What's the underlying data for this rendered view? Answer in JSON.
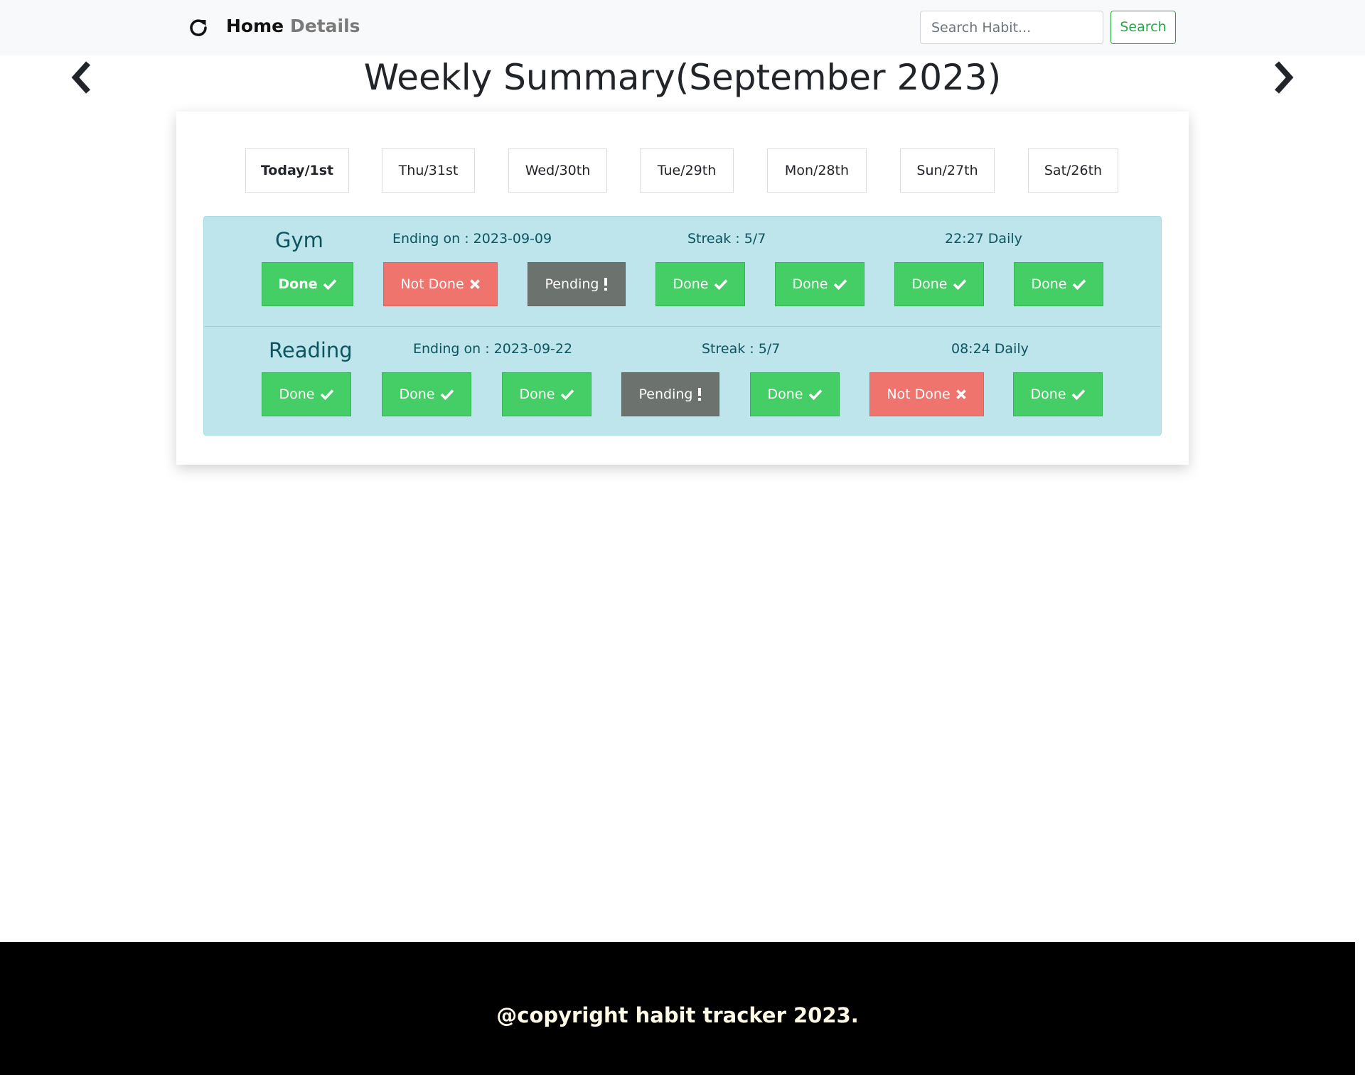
{
  "nav": {
    "home_label": "Home",
    "details_label": "Details",
    "search_placeholder": "Search Habit...",
    "search_button": "Search",
    "refresh_icon": "refresh-icon"
  },
  "page": {
    "title": "Weekly Summary(September 2023)",
    "prev_icon": "chevron-left-icon",
    "next_icon": "chevron-right-icon"
  },
  "days": [
    {
      "label": "Today/1st",
      "active": true
    },
    {
      "label": "Thu/31st"
    },
    {
      "label": "Wed/30th"
    },
    {
      "label": "Tue/29th"
    },
    {
      "label": "Mon/28th"
    },
    {
      "label": "Sun/27th"
    },
    {
      "label": "Sat/26th"
    }
  ],
  "habits": [
    {
      "name": "Gym",
      "ending": "Ending on : 2023-09-09",
      "streak": "Streak : 5/7",
      "schedule": "22:27 Daily",
      "statuses": [
        {
          "label": "Done",
          "type": "done"
        },
        {
          "label": "Not Done",
          "type": "notdone"
        },
        {
          "label": "Pending",
          "type": "pending"
        },
        {
          "label": "Done",
          "type": "done"
        },
        {
          "label": "Done",
          "type": "done"
        },
        {
          "label": "Done",
          "type": "done"
        },
        {
          "label": "Done",
          "type": "done"
        }
      ]
    },
    {
      "name": "Reading",
      "ending": "Ending on : 2023-09-22",
      "streak": "Streak : 5/7",
      "schedule": "08:24 Daily",
      "statuses": [
        {
          "label": "Done",
          "type": "done"
        },
        {
          "label": "Done",
          "type": "done"
        },
        {
          "label": "Done",
          "type": "done"
        },
        {
          "label": "Pending",
          "type": "pending"
        },
        {
          "label": "Done",
          "type": "done"
        },
        {
          "label": "Not Done",
          "type": "notdone"
        },
        {
          "label": "Done",
          "type": "done"
        }
      ]
    }
  ],
  "status_icons": {
    "done": "check-icon",
    "notdone": "x-icon",
    "pending": "exclamation-icon"
  },
  "colors": {
    "done": "#44ce65",
    "notdone": "#f0746e",
    "pending": "#6c736e",
    "habit_bg": "#bee5eb",
    "accent": "#28a745"
  },
  "footer": {
    "text": "@copyright habit tracker 2023."
  }
}
